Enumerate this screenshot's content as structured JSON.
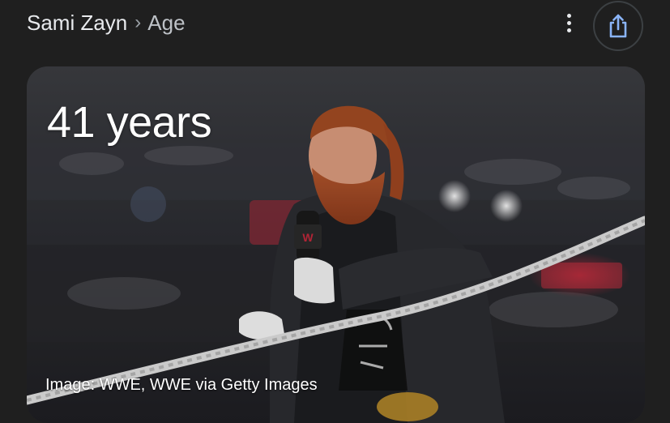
{
  "breadcrumb": {
    "entity": "Sami Zayn",
    "separator": "›",
    "attribute": "Age"
  },
  "actions": {
    "menu_icon": "more-vert-icon",
    "share_icon": "share-icon"
  },
  "card": {
    "age_value": "41 years",
    "image_credit": "Image: WWE, WWE via Getty Images"
  },
  "colors": {
    "background": "#1f1f1f",
    "share_accent": "#8ab4f8"
  }
}
